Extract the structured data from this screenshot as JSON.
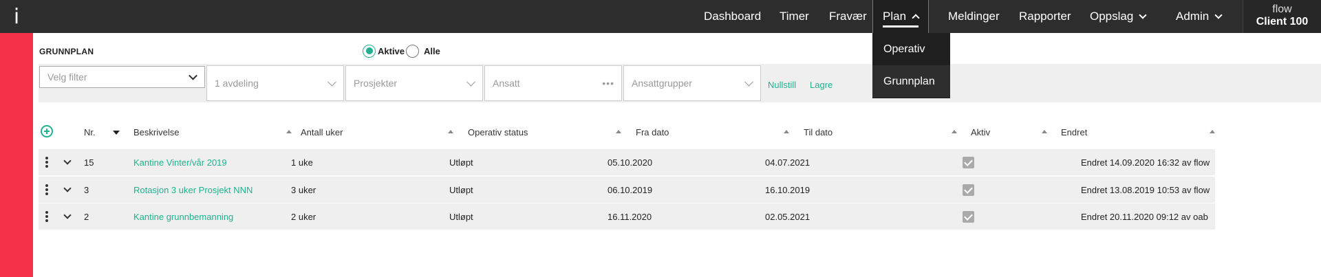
{
  "app": {
    "logo": "i",
    "user": "flow",
    "client": "Client 100"
  },
  "nav": [
    "Dashboard",
    "Timer",
    "Fravær",
    "Plan",
    "Meldinger",
    "Rapporter",
    "Oppslag",
    "Admin"
  ],
  "plan_menu": [
    "Operativ",
    "Grunnplan"
  ],
  "page": {
    "title": "GRUNNPLAN",
    "radio_active": "Aktive",
    "radio_all": "Alle",
    "filter_select": "Velg filter",
    "filter_dept": "1 avdeling",
    "filter_projects": "Prosjekter",
    "filter_employee": "Ansatt",
    "filter_groups": "Ansattgrupper",
    "reset_link": "Nullstill",
    "save_link": "Lagre"
  },
  "table": {
    "headers": [
      "Nr.",
      "Beskrivelse",
      "Antall uker",
      "Operativ status",
      "Fra dato",
      "Til dato",
      "Aktiv",
      "Endret"
    ],
    "rows": [
      {
        "nr": "15",
        "desc": "Kantine Vinter/vår 2019",
        "weeks": "1 uke",
        "status": "Utløpt",
        "from": "05.10.2020",
        "to": "04.07.2021",
        "active": true,
        "changed": "Endret 14.09.2020 16:32 av flow"
      },
      {
        "nr": "3",
        "desc": "Rotasjon 3 uker Prosjekt NNN",
        "weeks": "3 uker",
        "status": "Utløpt",
        "from": "06.10.2019",
        "to": "16.10.2019",
        "active": true,
        "changed": "Endret 13.08.2019 10:53 av flow"
      },
      {
        "nr": "2",
        "desc": "Kantine grunnbemanning",
        "weeks": "2 uker",
        "status": "Utløpt",
        "from": "16.11.2020",
        "to": "02.05.2021",
        "active": true,
        "changed": "Endret 20.11.2020 09:12 av oab"
      }
    ]
  },
  "colors": {
    "accent": "#20b28f",
    "sidebar": "#f4304a",
    "topbar": "#2d2d2d"
  }
}
